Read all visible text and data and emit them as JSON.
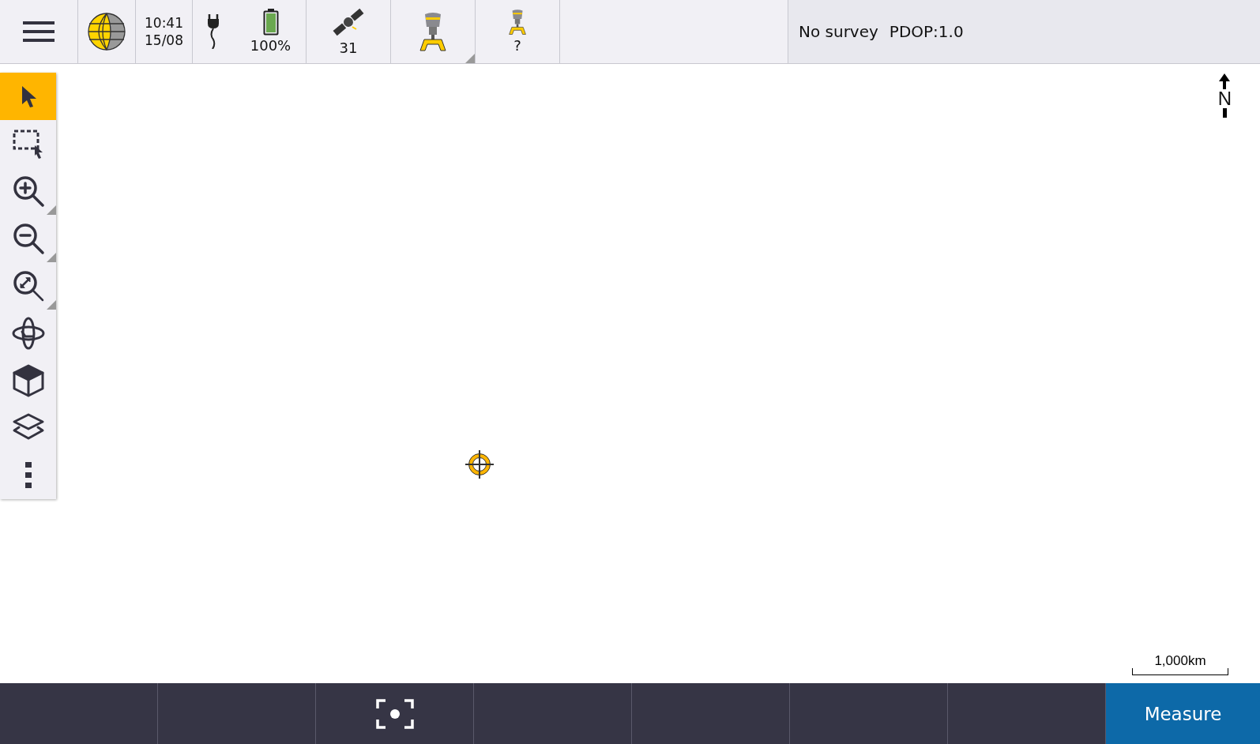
{
  "status_bar": {
    "clock": {
      "time": "10:41",
      "date": "15/08"
    },
    "battery": {
      "level": 1.0,
      "reading": "100%"
    },
    "satellites": "31",
    "rover_status": "?",
    "survey": "No survey",
    "pdop": "PDOP:1.0"
  },
  "map_tools": [
    {
      "kind": "select",
      "selected": true,
      "submenu": false
    },
    {
      "kind": "box-select",
      "selected": false,
      "submenu": false
    },
    {
      "kind": "zoom-in",
      "selected": false,
      "submenu": true
    },
    {
      "kind": "zoom-out",
      "selected": false,
      "submenu": true
    },
    {
      "kind": "zoom-extents",
      "selected": false,
      "submenu": true
    },
    {
      "kind": "orbit",
      "selected": false,
      "submenu": false
    },
    {
      "kind": "view-3d",
      "selected": false,
      "submenu": false
    },
    {
      "kind": "layers",
      "selected": false,
      "submenu": false
    },
    {
      "kind": "more",
      "selected": false,
      "submenu": false
    }
  ],
  "map": {
    "north_label": "N",
    "scale": "1,000km"
  },
  "bottom_bar": {
    "measure_button": "Measure"
  }
}
